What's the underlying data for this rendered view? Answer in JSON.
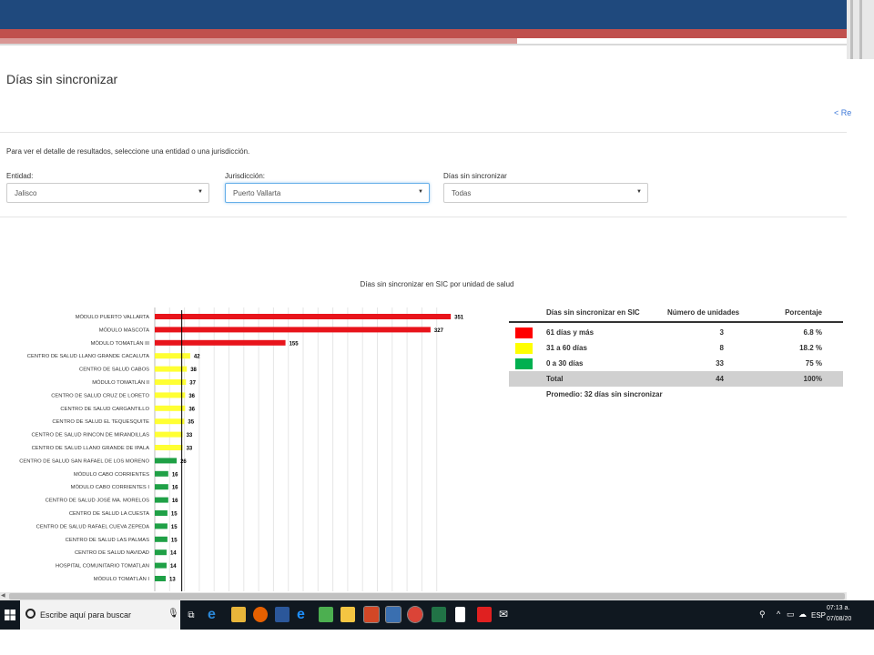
{
  "page": {
    "title": "Días sin sincronizar",
    "back_link": "< Re",
    "hint": "Para ver el detalle de resultados, seleccione una entidad o una jurisdicción."
  },
  "filters": {
    "entidad": {
      "label": "Entidad:",
      "value": "Jalisco"
    },
    "jurisdiccion": {
      "label": "Jurisdicción:",
      "value": "Puerto Vallarta"
    },
    "dias": {
      "label": "Días sin sincronizar",
      "value": "Todas"
    }
  },
  "chart_data": {
    "type": "bar",
    "orientation": "horizontal",
    "title": "Días sin sincronizar en SIC por unidad de salud",
    "categories": [
      "MÓDULO PUERTO VALLARTA",
      "MÓDULO MASCOTA",
      "MÓDULO TOMATLÁN III",
      "CENTRO DE SALUD LLANO GRANDE CACALUTA",
      "CENTRO DE SALUD CABOS",
      "MÓDULO TOMATLÁN II",
      "CENTRO DE SALUD CRUZ DE LORETO",
      "CENTRO DE SALUD CARGANTILLO",
      "CENTRO DE SALUD EL TEQUESQUITE",
      "CENTRO DE SALUD RINCON DE MIRANDILLAS",
      "CENTRO DE SALUD LLANO GRANDE DE IPALA",
      "CENTRO DE SALUD SAN RAFAEL DE LOS MORENO",
      "MÓDULO CABO CORRIENTES",
      "MÓDULO CABO CORRIENTES I",
      "CENTRO DE SALUD JOSÉ MA. MORELOS",
      "CENTRO DE SALUD LA CUESTA",
      "CENTRO DE SALUD RAFAEL CUEVA ZEPEDA",
      "CENTRO DE SALUD LAS PALMAS",
      "CENTRO DE SALUD NAVIDAD",
      "HOSPITAL COMUNITARIO TOMATLAN",
      "MÓDULO TOMATLÁN I"
    ],
    "values": [
      351,
      327,
      155,
      42,
      38,
      37,
      36,
      36,
      35,
      33,
      33,
      26,
      16,
      16,
      16,
      15,
      15,
      15,
      14,
      14,
      13
    ],
    "colors": [
      "#e8141b",
      "#e8141b",
      "#e8141b",
      "#ffff33",
      "#ffff33",
      "#ffff33",
      "#ffff33",
      "#ffff33",
      "#ffff33",
      "#ffff33",
      "#ffff33",
      "#1fa046",
      "#1fa046",
      "#1fa046",
      "#1fa046",
      "#1fa046",
      "#1fa046",
      "#1fa046",
      "#1fa046",
      "#1fa046",
      "#1fa046"
    ],
    "xlim": [
      0,
      380
    ],
    "reference_line": 32,
    "grid": true
  },
  "summary": {
    "headers": [
      "Días sin sincronizar en SIC",
      "Número de unidades",
      "Porcentaje"
    ],
    "rows": [
      {
        "label": "61 días y más",
        "count": "3",
        "pct": "6.8 %",
        "color": "#ff0000"
      },
      {
        "label": "31 a 60 días",
        "count": "8",
        "pct": "18.2 %",
        "color": "#ffff00"
      },
      {
        "label": "0 a 30 días",
        "count": "33",
        "pct": "75 %",
        "color": "#00b050"
      }
    ],
    "total": {
      "label": "Total",
      "count": "44",
      "pct": "100%"
    },
    "average": "Promedio: 32 días sin sincronizar"
  },
  "taskbar": {
    "search_placeholder": "Escribe aquí para buscar",
    "language": "ESP",
    "time": "07:13 a.",
    "date": "07/08/20"
  }
}
